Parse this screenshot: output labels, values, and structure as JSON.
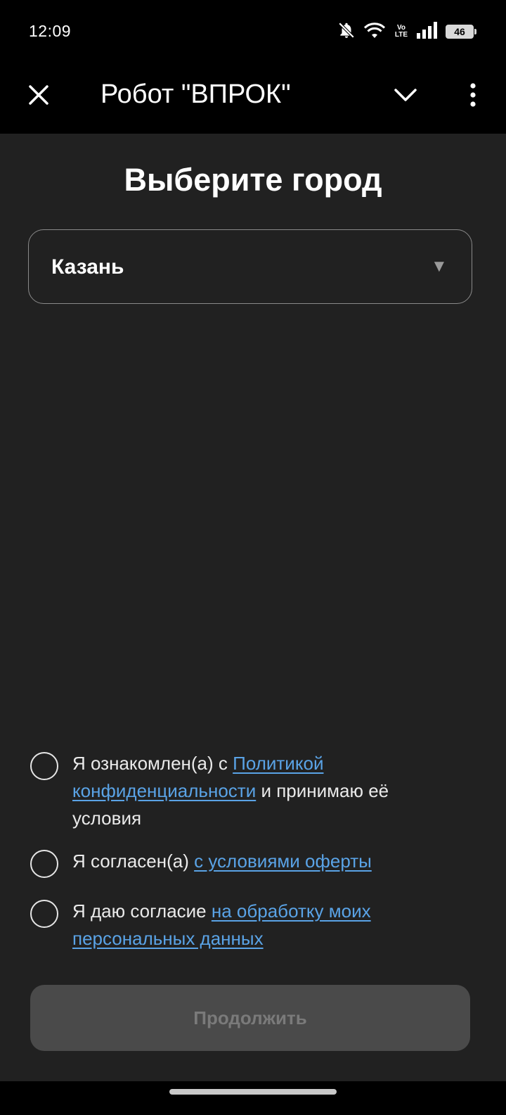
{
  "status_bar": {
    "time": "12:09",
    "volte": [
      "Vo",
      "LTE"
    ],
    "battery": "46",
    "icons": [
      "notifications-off-icon",
      "wifi-icon",
      "volte-icon",
      "signal-icon",
      "battery-icon"
    ]
  },
  "app_bar": {
    "title": "Робот \"ВПРОК\"",
    "icons": [
      "close-icon",
      "chevron-down-icon",
      "more-vert-icon"
    ]
  },
  "page": {
    "title": "Выберите город"
  },
  "city_select": {
    "value": "Казань",
    "arrow": "▼"
  },
  "consents": [
    {
      "checked": false,
      "before": "Я ознакомлен(а) с ",
      "link": "Политикой конфиденциальности",
      "after": " и принимаю её условия"
    },
    {
      "checked": false,
      "before": "Я согласен(а) ",
      "link": "с условиями оферты",
      "after": ""
    },
    {
      "checked": false,
      "before": "Я даю согласие ",
      "link": "на обработку моих персональных данных",
      "after": ""
    }
  ],
  "continue_button": {
    "label": "Продолжить",
    "enabled": false
  },
  "colors": {
    "background": "#212121",
    "bars": "#000000",
    "link": "#5aa3e6",
    "button_disabled_bg": "#4a4a4a",
    "button_disabled_text": "#7a7a7a"
  }
}
